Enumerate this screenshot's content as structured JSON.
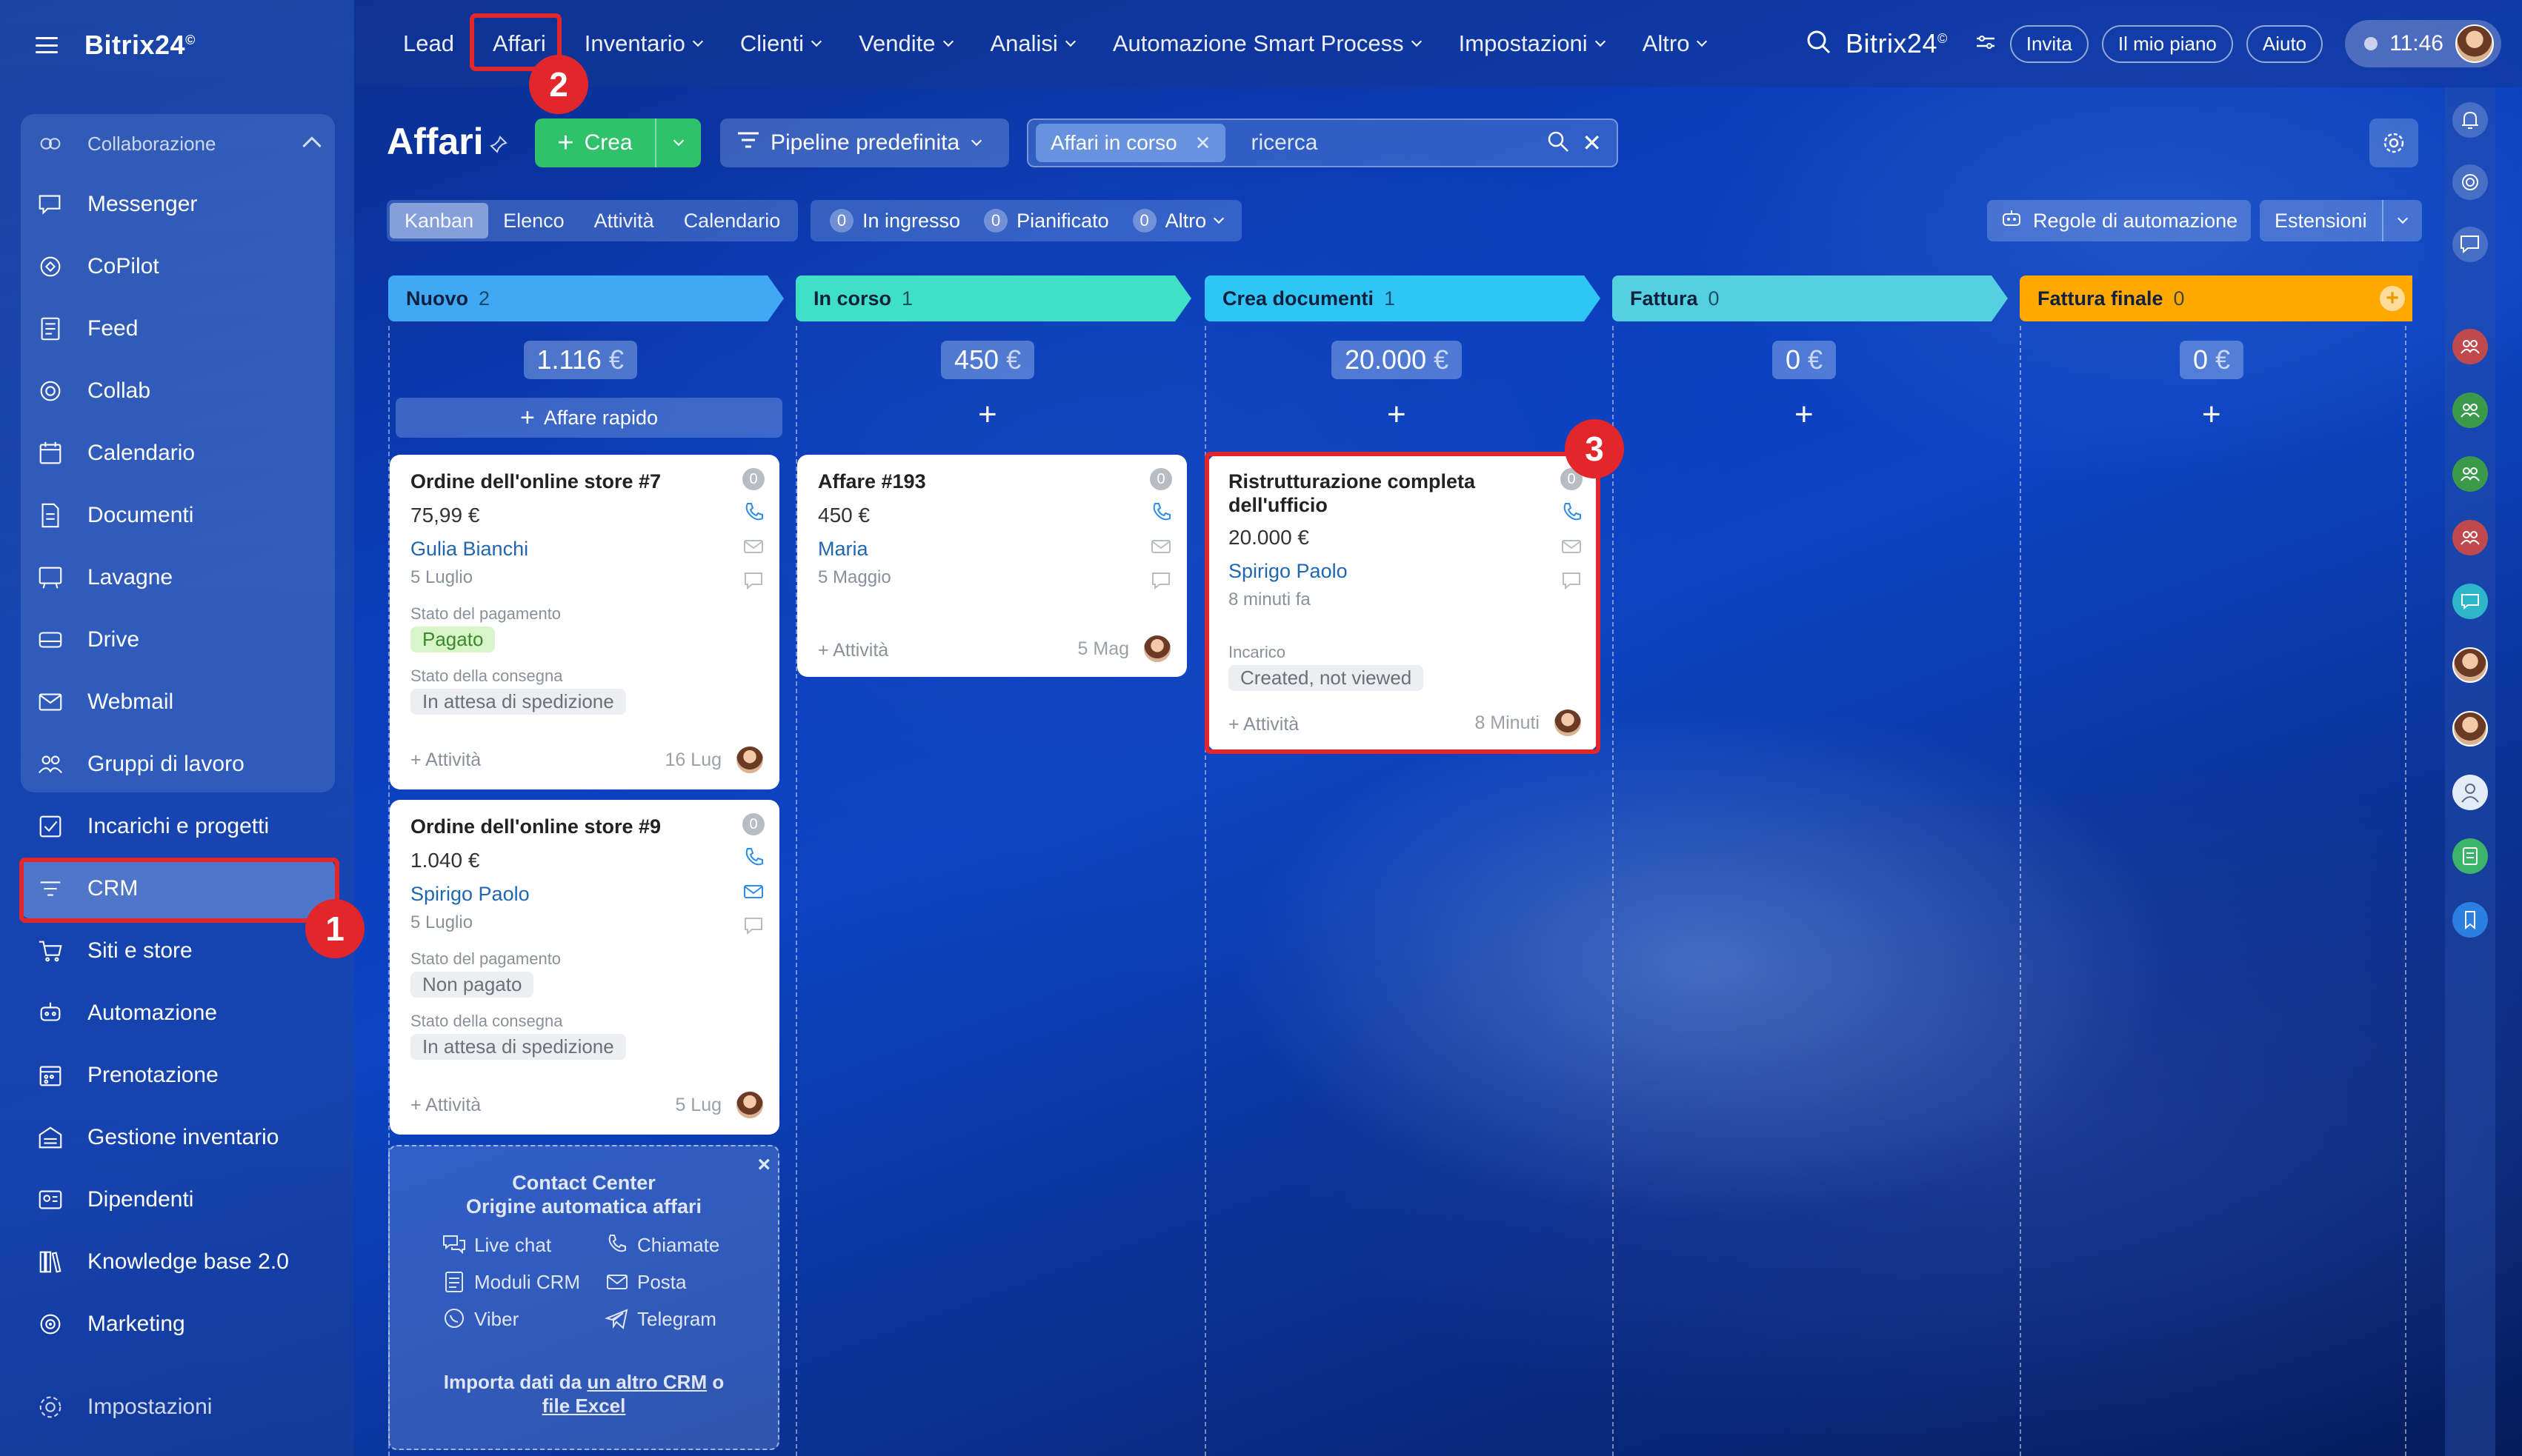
{
  "app": {
    "brand": "Bitrix24",
    "brand_mark": "©",
    "time": "11:46"
  },
  "sidebar": {
    "group_label": "Collaborazione",
    "items": [
      {
        "label": "Messenger",
        "icon": "chat-icon"
      },
      {
        "label": "CoPilot",
        "icon": "copilot-icon"
      },
      {
        "label": "Feed",
        "icon": "feed-icon"
      },
      {
        "label": "Collab",
        "icon": "collab-icon"
      },
      {
        "label": "Calendario",
        "icon": "calendar-icon"
      },
      {
        "label": "Documenti",
        "icon": "document-icon"
      },
      {
        "label": "Lavagne",
        "icon": "board-icon"
      },
      {
        "label": "Drive",
        "icon": "drive-icon"
      },
      {
        "label": "Webmail",
        "icon": "mail-icon"
      },
      {
        "label": "Gruppi di lavoro",
        "icon": "group-icon"
      }
    ],
    "items2": [
      {
        "label": "Incarichi e progetti",
        "icon": "task-icon"
      },
      {
        "label": "CRM",
        "icon": "crm-icon"
      },
      {
        "label": "Siti e store",
        "icon": "cart-icon"
      },
      {
        "label": "Automazione",
        "icon": "robot-icon"
      },
      {
        "label": "Prenotazione",
        "icon": "booking-icon"
      },
      {
        "label": "Gestione inventario",
        "icon": "inventory-icon"
      },
      {
        "label": "Dipendenti",
        "icon": "employees-icon"
      },
      {
        "label": "Knowledge base 2.0",
        "icon": "books-icon"
      },
      {
        "label": "Marketing",
        "icon": "marketing-icon"
      }
    ],
    "settings": "Impostazioni"
  },
  "topnav": {
    "items": [
      "Lead",
      "Affari",
      "Inventario",
      "Clienti",
      "Vendite",
      "Analisi",
      "Automazione Smart Process",
      "Impostazioni",
      "Altro"
    ],
    "invite": "Invita",
    "plan": "Il mio piano",
    "help": "Aiuto"
  },
  "header": {
    "title": "Affari",
    "create": "Crea",
    "pipeline": "Pipeline predefinita",
    "filter_chip": "Affari in corso",
    "search_placeholder": "ricerca"
  },
  "views": {
    "tabs": [
      "Kanban",
      "Elenco",
      "Attività",
      "Calendario"
    ],
    "counters": [
      {
        "num": "0",
        "label": "In ingresso"
      },
      {
        "num": "0",
        "label": "Pianificato"
      },
      {
        "num": "0",
        "label": "Altro"
      }
    ],
    "automation_rules": "Regole di automazione",
    "extensions": "Estensioni"
  },
  "columns": [
    {
      "name": "Nuovo",
      "count": "2",
      "sum": "1.116",
      "currency": "€",
      "color": "#3fa9f5"
    },
    {
      "name": "In corso",
      "count": "1",
      "sum": "450",
      "currency": "€",
      "color": "#3fe0c5"
    },
    {
      "name": "Crea documenti",
      "count": "1",
      "sum": "20.000",
      "currency": "€",
      "color": "#2fc6f6"
    },
    {
      "name": "Fattura",
      "count": "0",
      "sum": "0",
      "currency": "€",
      "color": "#55d0e0"
    },
    {
      "name": "Fattura finale",
      "count": "0",
      "sum": "0",
      "currency": "€",
      "color": "#ffa900"
    }
  ],
  "quick_deal": "Affare rapido",
  "cards": {
    "c1": {
      "title": "Ordine dell'online store #7",
      "amount": "75,99 €",
      "person": "Gulia Bianchi",
      "date": "5 Luglio",
      "pay_label": "Stato del pagamento",
      "pay_value": "Pagato",
      "ship_label": "Stato della consegna",
      "ship_value": "In attesa di spedizione",
      "activity": "+ Attività",
      "when": "16 Lug"
    },
    "c2": {
      "title": "Ordine dell'online store #9",
      "amount": "1.040 €",
      "person": "Spirigo Paolo",
      "date": "5 Luglio",
      "pay_label": "Stato del pagamento",
      "pay_value": "Non pagato",
      "ship_label": "Stato della consegna",
      "ship_value": "In attesa di spedizione",
      "activity": "+ Attività",
      "when": "5 Lug"
    },
    "c3": {
      "title": "Affare #193",
      "amount": "450 €",
      "person": "Maria",
      "date": "5 Maggio",
      "activity": "+ Attività",
      "when": "5 Mag"
    },
    "c4": {
      "title": "Ristrutturazione completa dell'ufficio",
      "amount": "20.000 €",
      "person": "Spirigo Paolo",
      "date": "8 minuti fa",
      "task_label": "Incarico",
      "task_value": "Created, not viewed",
      "activity": "+ Attività",
      "when": "8 Minuti"
    },
    "zero": "0"
  },
  "promo": {
    "title1": "Contact Center",
    "title2": "Origine automatica affari",
    "channels": [
      "Live chat",
      "Chiamate",
      "Moduli CRM",
      "Posta",
      "Viber",
      "Telegram"
    ],
    "import_prefix": "Importa dati da",
    "import_link1": "un altro CRM",
    "import_mid": "o",
    "import_link2": "file Excel",
    "close": "×"
  },
  "annotations": [
    "1",
    "2",
    "3"
  ],
  "colors": {
    "accent_green": "#2fc26b",
    "highlight_red": "#e3262b",
    "link_blue": "#2066b0"
  }
}
